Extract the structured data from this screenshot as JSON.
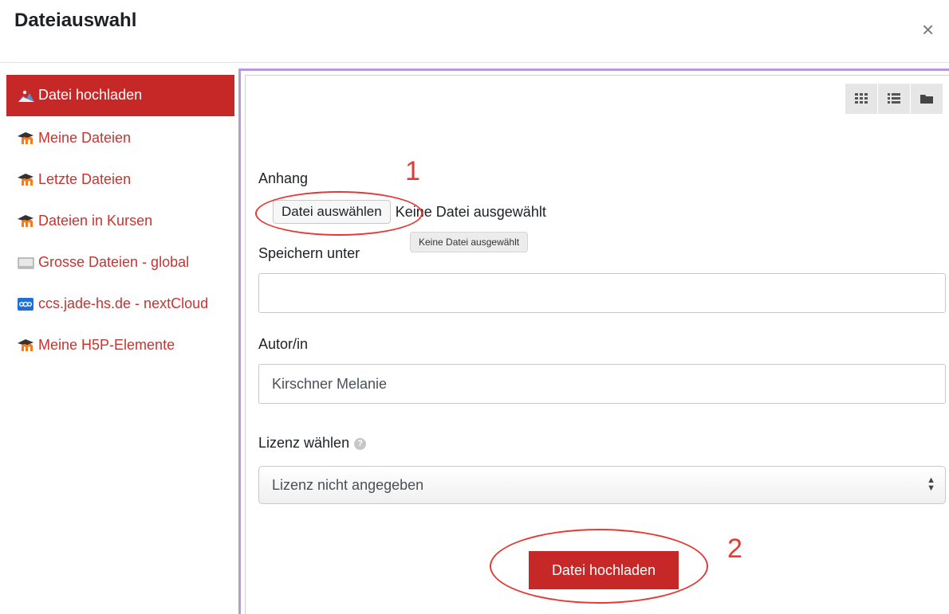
{
  "dialog": {
    "title": "Dateiauswahl",
    "close_symbol": "×"
  },
  "sidebar": {
    "items": [
      {
        "label": "Datei hochladen",
        "icon": "upload-icon",
        "active": true
      },
      {
        "label": "Meine Dateien",
        "icon": "moodle-logo-icon",
        "active": false
      },
      {
        "label": "Letzte Dateien",
        "icon": "moodle-logo-icon",
        "active": false
      },
      {
        "label": "Dateien in Kursen",
        "icon": "moodle-logo-icon",
        "active": false
      },
      {
        "label": "Grosse Dateien - global",
        "icon": "file-system-icon",
        "active": false
      },
      {
        "label": "ccs.jade-hs.de - nextCloud",
        "icon": "nextcloud-icon",
        "active": false
      },
      {
        "label": "Meine H5P-Elemente",
        "icon": "moodle-logo-icon",
        "active": false
      }
    ]
  },
  "view_toggles": [
    "grid-view-icon",
    "list-view-icon",
    "folder-view-icon"
  ],
  "form": {
    "attachment_label": "Anhang",
    "choose_file_label": "Datei auswählen",
    "file_status": "Keine Datei ausgewählt",
    "tooltip": "Keine Datei ausgewählt",
    "save_as_label": "Speichern unter",
    "save_as_value": "",
    "author_label": "Autor/in",
    "author_value": "Kirschner Melanie",
    "license_label": "Lizenz wählen",
    "license_selected": "Lizenz nicht angegeben",
    "upload_button": "Datei hochladen"
  },
  "annotations": {
    "step1": "1",
    "step2": "2",
    "color": "#e53935"
  },
  "colors": {
    "accent": "#c62828",
    "link": "#c9332f",
    "pane_border": "#b99ad8"
  }
}
